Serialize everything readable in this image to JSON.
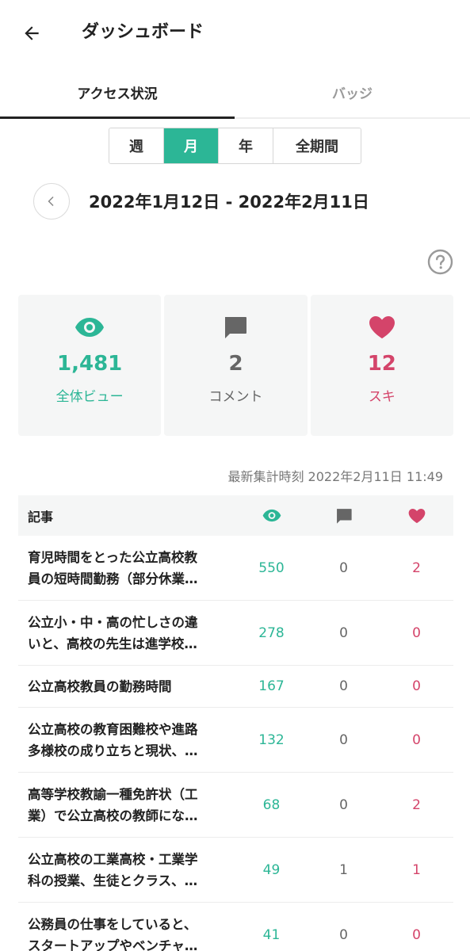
{
  "header": {
    "title": "ダッシュボード",
    "back_icon": "arrow-left-icon"
  },
  "tabs": [
    {
      "label": "アクセス状況",
      "active": true
    },
    {
      "label": "バッジ",
      "active": false
    }
  ],
  "period": {
    "options": [
      "週",
      "月",
      "年",
      "全期間"
    ],
    "selected": "月"
  },
  "date_range": "2022年1月12日 - 2022年2月11日",
  "stats": {
    "views": {
      "value": "1,481",
      "label": "全体ビュー",
      "icon": "eye-icon"
    },
    "comments": {
      "value": "2",
      "label": "コメント",
      "icon": "comment-icon"
    },
    "likes": {
      "value": "12",
      "label": "スキ",
      "icon": "heart-icon"
    }
  },
  "updated_at": "最新集計時刻 2022年2月11日 11:49",
  "table": {
    "header_label": "記事",
    "rows": [
      {
        "title": "育児時間をとった公立高校教\n員の短時間勤務（部分休業…",
        "views": "550",
        "comments": "0",
        "likes": "2"
      },
      {
        "title": "公立小・中・高の忙しさの違\nいと、高校の先生は進学校…",
        "views": "278",
        "comments": "0",
        "likes": "0"
      },
      {
        "title": "公立高校教員の勤務時間",
        "views": "167",
        "comments": "0",
        "likes": "0"
      },
      {
        "title": "公立高校の教育困難校や進路\n多様校の成り立ちと現状、…",
        "views": "132",
        "comments": "0",
        "likes": "0"
      },
      {
        "title": "高等学校教諭一種免許状（工\n業）で公立高校の教師にな…",
        "views": "68",
        "comments": "0",
        "likes": "2"
      },
      {
        "title": "公立高校の工業高校・工業学\n科の授業、生徒とクラス、…",
        "views": "49",
        "comments": "1",
        "likes": "1"
      },
      {
        "title": "公務員の仕事をしていると、\nスタートアップやベンチャ…",
        "views": "41",
        "comments": "0",
        "likes": "0"
      }
    ]
  },
  "colors": {
    "accent": "#2cb696",
    "like": "#d4446a",
    "muted": "#666666"
  }
}
